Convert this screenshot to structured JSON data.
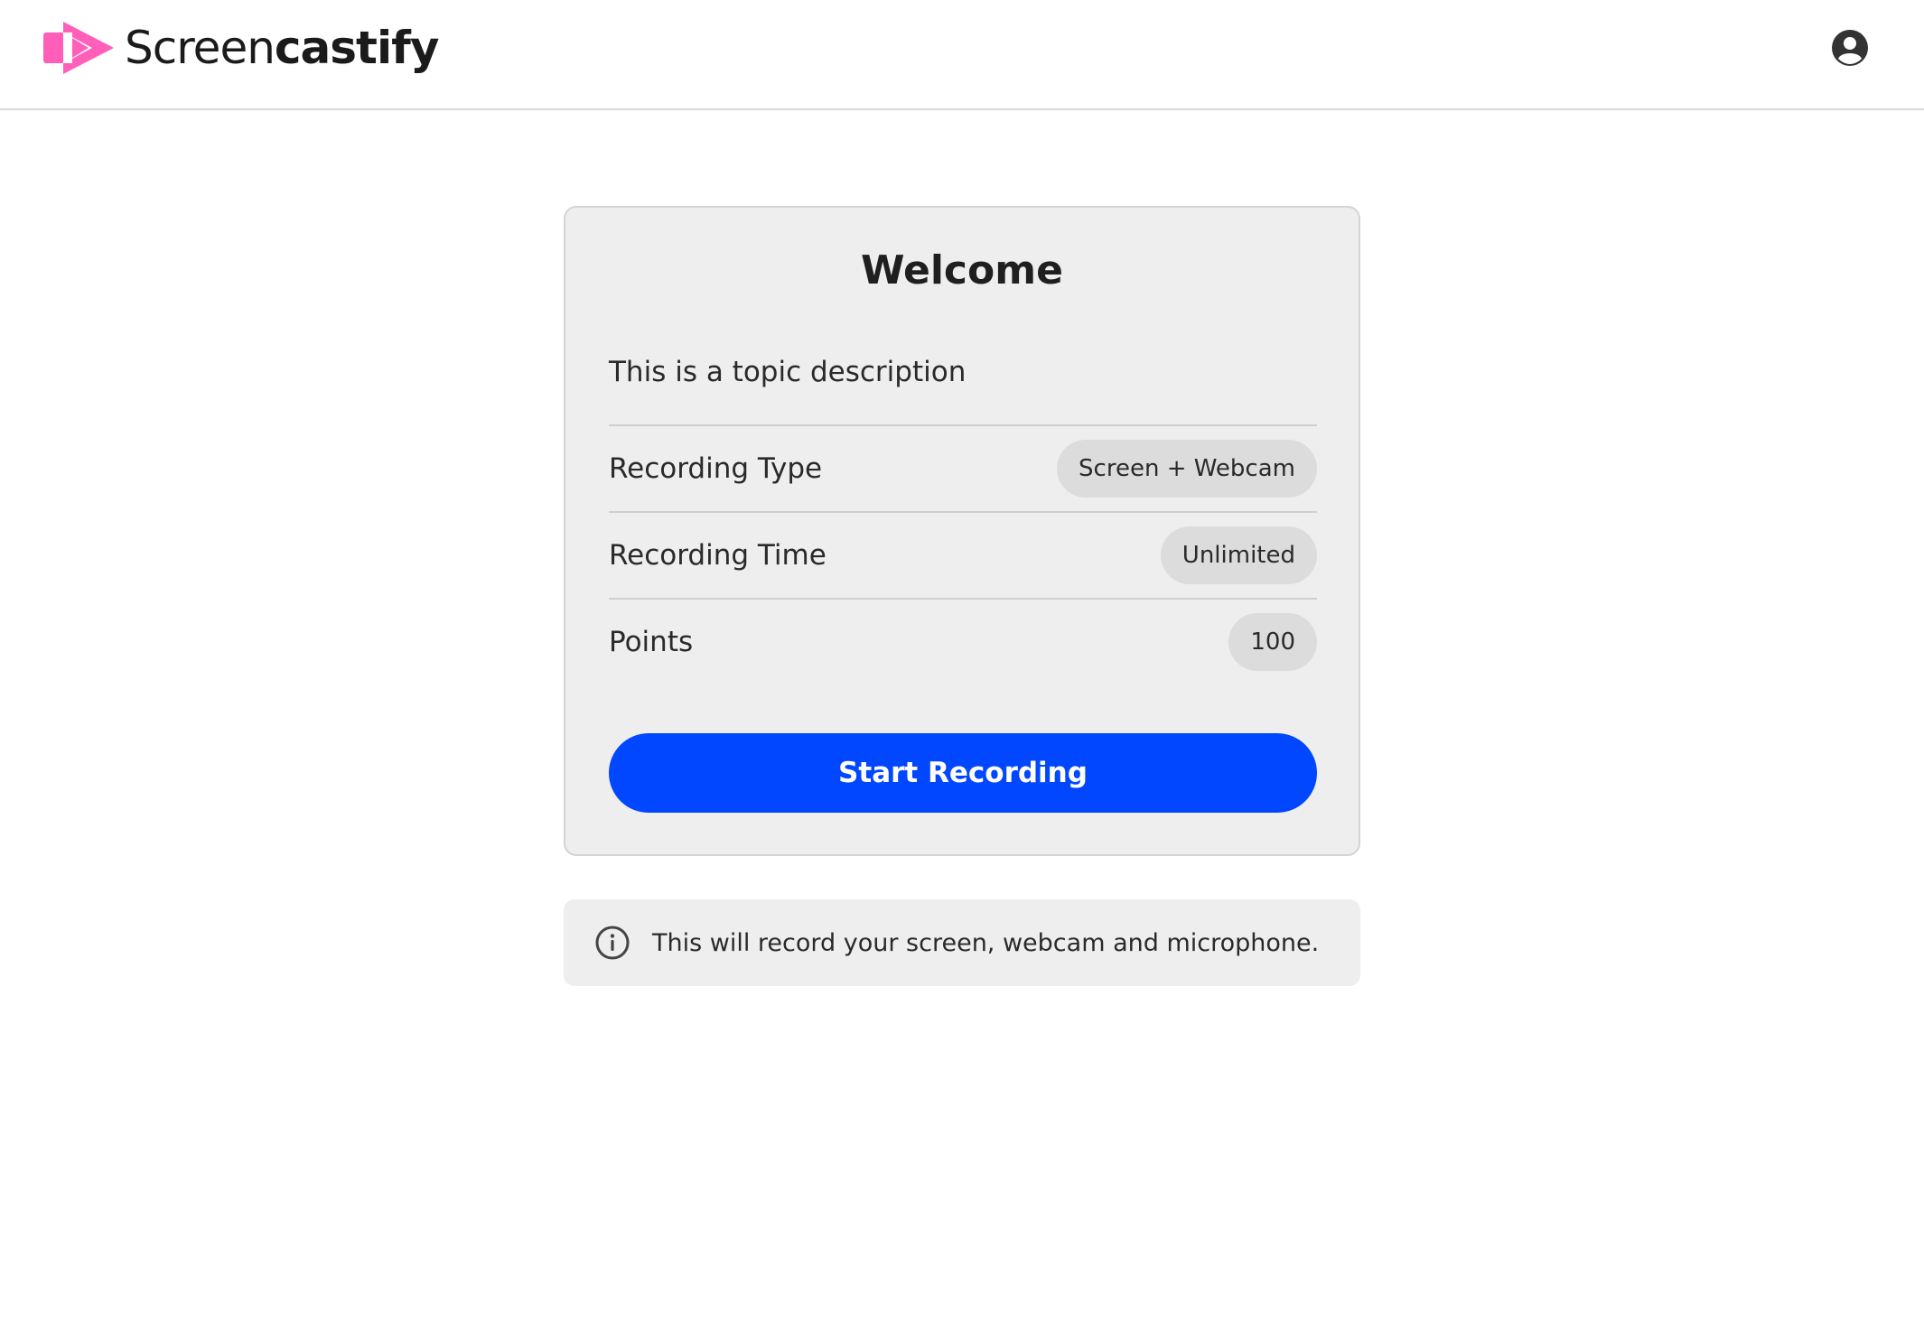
{
  "header": {
    "logo_text_light": "Screen",
    "logo_text_bold": "castify",
    "account_icon": "account-circle-icon"
  },
  "card": {
    "title": "Welcome",
    "description": "This is a topic description",
    "rows": [
      {
        "label": "Recording Type",
        "value": "Screen + Webcam"
      },
      {
        "label": "Recording Time",
        "value": "Unlimited"
      },
      {
        "label": "Points",
        "value": "100"
      }
    ],
    "button_label": "Start Recording"
  },
  "notice": {
    "icon": "info-icon",
    "text": "This will record your screen, webcam and microphone."
  },
  "colors": {
    "brand_pink": "#ff5fb8",
    "primary_button": "#0047ff",
    "card_background": "#eeeeee",
    "pill_background": "#dcdcdc"
  }
}
